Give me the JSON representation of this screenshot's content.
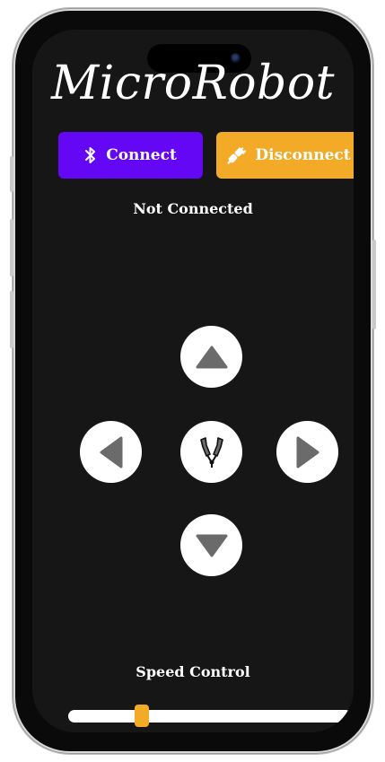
{
  "app": {
    "title": "MicroRobot"
  },
  "buttons": {
    "connect_label": "Connect",
    "connect_icon": "bluetooth-icon",
    "disconnect_label": "Disconnect",
    "disconnect_icon": "plug-disconnect-icon"
  },
  "status": {
    "text": "Not Connected"
  },
  "controls": {
    "up": "arrow-up-icon",
    "down": "arrow-down-icon",
    "left": "arrow-left-icon",
    "right": "arrow-right-icon",
    "center": "gripper-claw-icon"
  },
  "speed": {
    "label": "Speed Control",
    "value_fraction": 0.26
  },
  "colors": {
    "background": "#161616",
    "connect": "#6407f5",
    "disconnect": "#f3aa26",
    "arrow": "#6b6b6b",
    "text": "#ffffff"
  }
}
